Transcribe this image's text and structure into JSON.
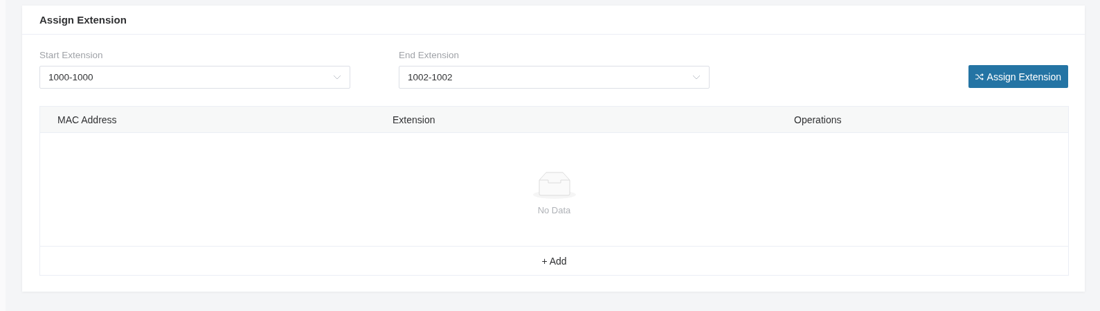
{
  "card": {
    "title": "Assign Extension"
  },
  "fields": [
    {
      "label": "Start Extension",
      "value": "1000-1000"
    },
    {
      "label": "End Extension",
      "value": "1002-1002"
    }
  ],
  "assign_button": {
    "label": "Assign Extension"
  },
  "table": {
    "columns": [
      "MAC Address",
      "Extension",
      "Operations"
    ],
    "empty_text": "No Data",
    "add_label": "+ Add"
  }
}
